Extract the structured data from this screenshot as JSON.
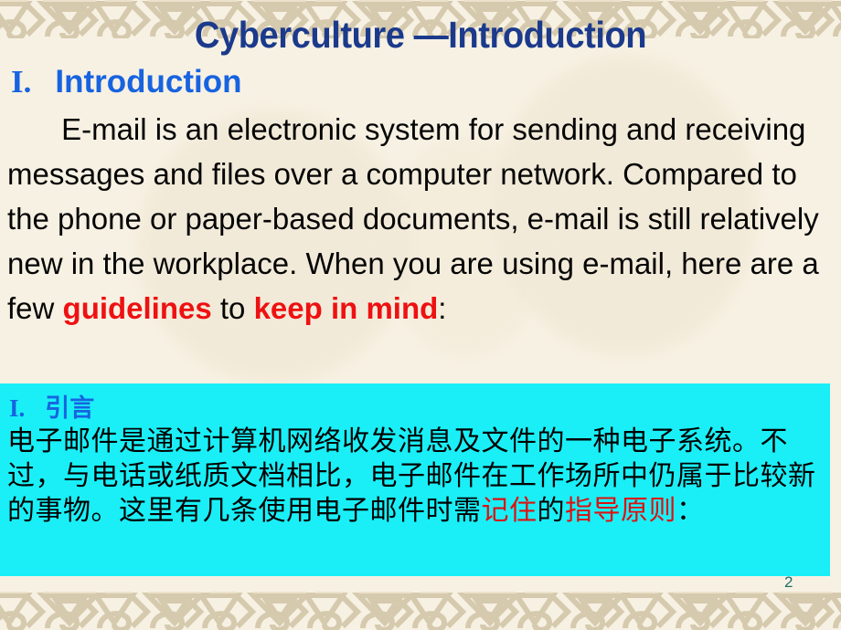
{
  "slide": {
    "background_color": "#f7f1e3",
    "pattern_color": "#d7cbb0",
    "title": "Cyberculture  —Introduction",
    "page_number": "2"
  },
  "section": {
    "numeral": "I.",
    "heading": "Introduction",
    "heading_color": "#1763e0"
  },
  "english_body": {
    "part1": "E-mail is an electronic system for sending and receiving messages and files over a computer network. Compared to the phone or paper-based documents, e-mail is still relatively new in the workplace. When you are using e-mail, here are a few ",
    "highlight1": "guidelines",
    "part2": " to ",
    "highlight2": "keep in mind",
    "part3": ":",
    "highlight_color": "#ee1111"
  },
  "translation": {
    "background_color": "#1aeff7",
    "numeral": "I.",
    "heading": "引言",
    "heading_color": "#1763e0",
    "part1": "电子邮件是通过计算机网络收发消息及文件的一种电子系统。不过，与电话或纸质文档相比，电子邮件在工作场所中仍属于比较新的事物。这里有几条使用电子邮件时需",
    "highlight1": "记住",
    "part2": "的",
    "highlight2": "指导原则",
    "part3": "：",
    "highlight_color": "#dd1111"
  }
}
